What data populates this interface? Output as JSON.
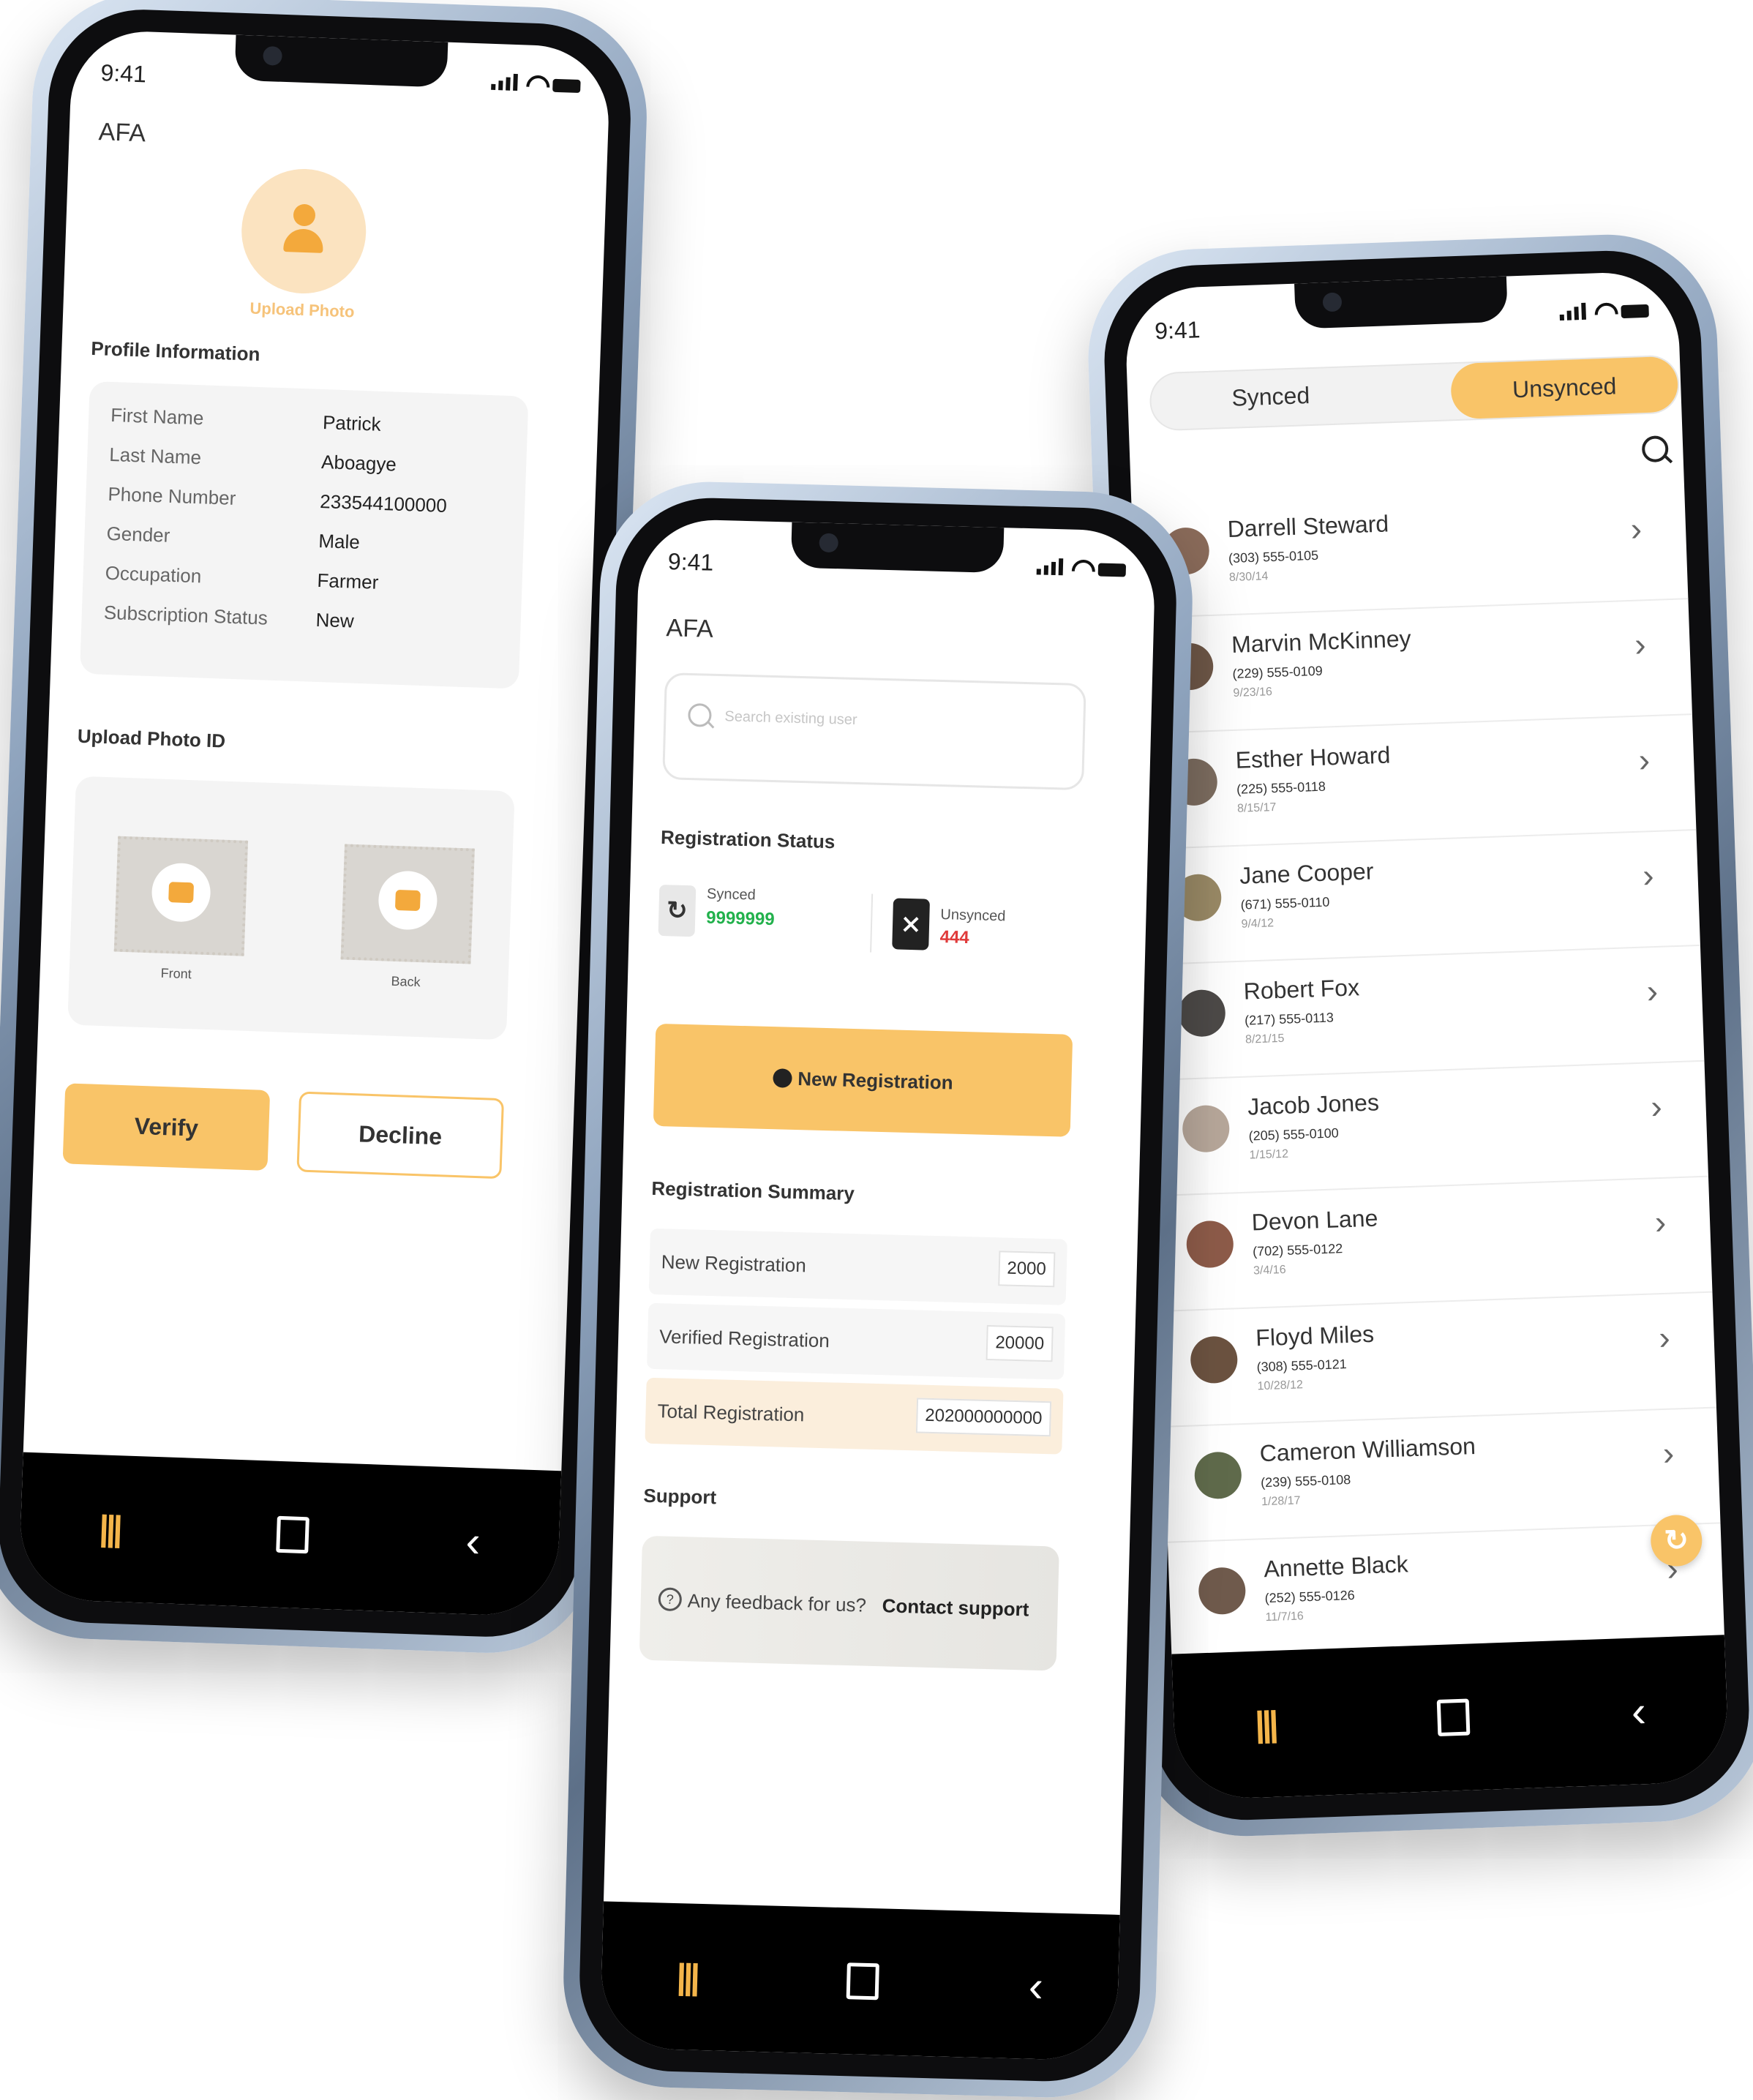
{
  "status_time": "9:41",
  "phone1": {
    "app_title": "AFA",
    "upload_photo_label": "Upload Photo",
    "profile_section_title": "Profile Information",
    "profile_fields": [
      {
        "label": "First Name",
        "value": "Patrick"
      },
      {
        "label": "Last Name",
        "value": "Aboagye"
      },
      {
        "label": "Phone Number",
        "value": "233544100000"
      },
      {
        "label": "Gender",
        "value": "Male"
      },
      {
        "label": "Occupation",
        "value": "Farmer"
      },
      {
        "label": "Subscription Status",
        "value": "New"
      }
    ],
    "upload_id_title": "Upload Photo ID",
    "front_label": "Front",
    "back_label": "Back",
    "verify_label": "Verify",
    "decline_label": "Decline"
  },
  "phone2": {
    "app_title": "AFA",
    "search_placeholder": "Search existing user",
    "registration_status_title": "Registration Status",
    "synced_label": "Synced",
    "synced_value": "9999999",
    "unsynced_label": "Unsynced",
    "unsynced_value": "444",
    "new_registration_button": "New Registration",
    "summary_title": "Registration Summary",
    "summary_rows": [
      {
        "label": "New Registration",
        "value": "2000"
      },
      {
        "label": "Verified Registration",
        "value": "20000"
      },
      {
        "label": "Total Registration",
        "value": "202000000000"
      }
    ],
    "support_title": "Support",
    "support_text": "Any feedback for us?",
    "support_link": "Contact support"
  },
  "phone3": {
    "tab_synced": "Synced",
    "tab_unsynced": "Unsynced",
    "contacts": [
      {
        "name": "Darrell Steward",
        "phone": "(303) 555-0105",
        "date": "8/30/14",
        "color": "#8a6b5a"
      },
      {
        "name": "Marvin McKinney",
        "phone": "(229) 555-0109",
        "date": "9/23/16",
        "color": "#6f5848"
      },
      {
        "name": "Esther Howard",
        "phone": "(225) 555-0118",
        "date": "8/15/17",
        "color": "#7d6d60"
      },
      {
        "name": "Jane Cooper",
        "phone": "(671) 555-0110",
        "date": "9/4/12",
        "color": "#9a8a66"
      },
      {
        "name": "Robert Fox",
        "phone": "(217) 555-0113",
        "date": "8/21/15",
        "color": "#4d4a48"
      },
      {
        "name": "Jacob Jones",
        "phone": "(205) 555-0100",
        "date": "1/15/12",
        "color": "#b7a79a"
      },
      {
        "name": "Devon Lane",
        "phone": "(702) 555-0122",
        "date": "3/4/16",
        "color": "#8d5b49"
      },
      {
        "name": "Floyd Miles",
        "phone": "(308) 555-0121",
        "date": "10/28/12",
        "color": "#6b5240"
      },
      {
        "name": "Cameron Williamson",
        "phone": "(239) 555-0108",
        "date": "1/28/17",
        "color": "#5f6a4b"
      },
      {
        "name": "Annette Black",
        "phone": "(252) 555-0126",
        "date": "11/7/16",
        "color": "#6f5a4c"
      }
    ]
  }
}
